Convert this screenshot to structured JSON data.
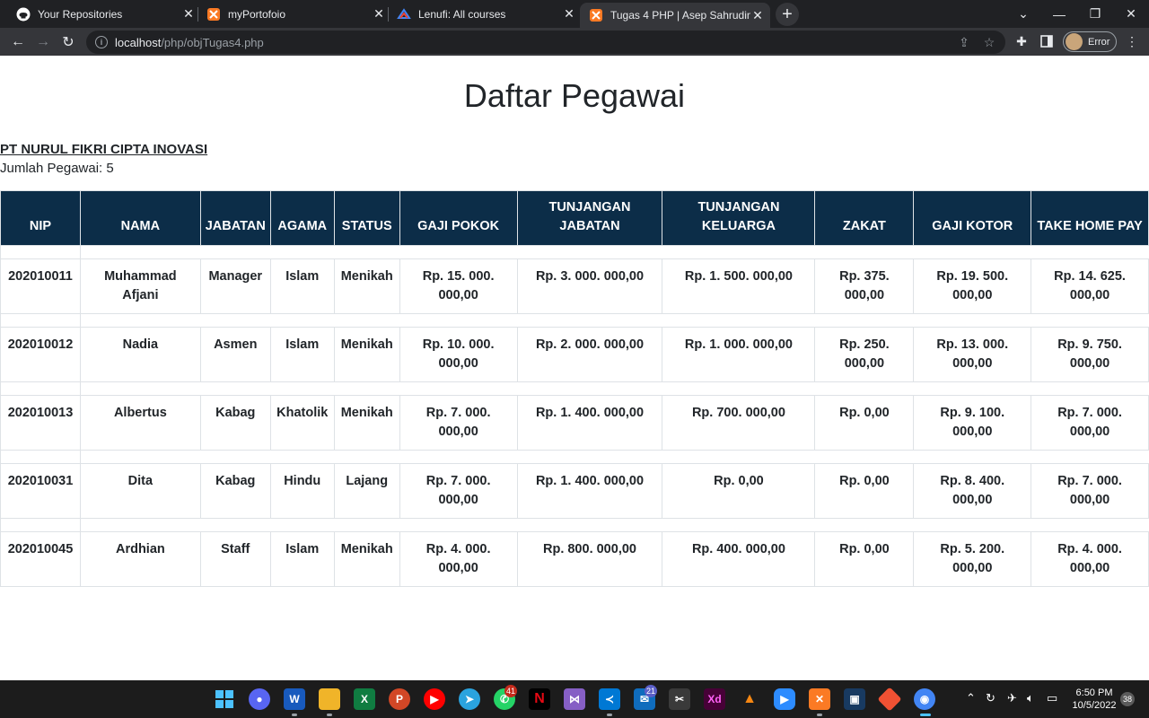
{
  "browser": {
    "tabs": [
      {
        "title": "Your Repositories",
        "icon": "github-icon"
      },
      {
        "title": "myPortofoio",
        "icon": "xampp-icon"
      },
      {
        "title": "Lenufi: All courses",
        "icon": "lenufi-icon"
      },
      {
        "title": "Tugas 4 PHP | Asep Sahrudin",
        "icon": "xampp-icon",
        "active": true
      }
    ],
    "url_host": "localhost",
    "url_path": "/php/objTugas4.php",
    "profile_status": "Error"
  },
  "page": {
    "title": "Daftar Pegawai",
    "company": "PT NURUL FIKRI CIPTA INOVASI",
    "employee_count_label": "Jumlah Pegawai: 5"
  },
  "table": {
    "headers": [
      "NIP",
      "NAMA",
      "JABATAN",
      "AGAMA",
      "STATUS",
      "GAJI POKOK",
      "TUNJANGAN JABATAN",
      "TUNJANGAN KELUARGA",
      "ZAKAT",
      "GAJI KOTOR",
      "TAKE HOME PAY"
    ],
    "rows": [
      [
        "202010011",
        "Muhammad Afjani",
        "Manager",
        "Islam",
        "Menikah",
        "Rp. 15. 000. 000,00",
        "Rp. 3. 000. 000,00",
        "Rp. 1. 500. 000,00",
        "Rp. 375. 000,00",
        "Rp. 19. 500. 000,00",
        "Rp. 14. 625. 000,00"
      ],
      [
        "202010012",
        "Nadia",
        "Asmen",
        "Islam",
        "Menikah",
        "Rp. 10. 000. 000,00",
        "Rp. 2. 000. 000,00",
        "Rp. 1. 000. 000,00",
        "Rp. 250. 000,00",
        "Rp. 13. 000. 000,00",
        "Rp. 9. 750. 000,00"
      ],
      [
        "202010013",
        "Albertus",
        "Kabag",
        "Khatolik",
        "Menikah",
        "Rp. 7. 000. 000,00",
        "Rp. 1. 400. 000,00",
        "Rp. 700. 000,00",
        "Rp. 0,00",
        "Rp. 9. 100. 000,00",
        "Rp. 7. 000. 000,00"
      ],
      [
        "202010031",
        "Dita",
        "Kabag",
        "Hindu",
        "Lajang",
        "Rp. 7. 000. 000,00",
        "Rp. 1. 400. 000,00",
        "Rp. 0,00",
        "Rp. 0,00",
        "Rp. 8. 400. 000,00",
        "Rp. 7. 000. 000,00"
      ],
      [
        "202010045",
        "Ardhian",
        "Staff",
        "Islam",
        "Menikah",
        "Rp. 4. 000. 000,00",
        "Rp. 800. 000,00",
        "Rp. 400. 000,00",
        "Rp. 0,00",
        "Rp. 5. 200. 000,00",
        "Rp. 4. 000. 000,00"
      ]
    ]
  },
  "taskbar": {
    "apps": [
      "windows-start-icon",
      "discord-icon",
      "word-icon",
      "file-explorer-icon",
      "excel-icon",
      "powerpoint-icon",
      "youtube-music-icon",
      "telegram-icon",
      "whatsapp-icon",
      "netflix-icon",
      "visual-studio-icon",
      "vscode-icon",
      "mail-icon",
      "snipping-tool-icon",
      "adobe-xd-icon",
      "arc-icon",
      "zoom-icon",
      "xampp-icon",
      "virtualbox-icon",
      "git-icon",
      "chrome-icon"
    ],
    "whatsapp_badge": "41",
    "mail_badge": "21",
    "time": "6:50 PM",
    "date": "10/5/2022",
    "notification_count": "38"
  },
  "colors": {
    "table_header_bg": "#0c2d48",
    "tab_strip_bg": "#202124",
    "toolbar_bg": "#35363a",
    "taskbar_bg": "#1c1c1c"
  }
}
